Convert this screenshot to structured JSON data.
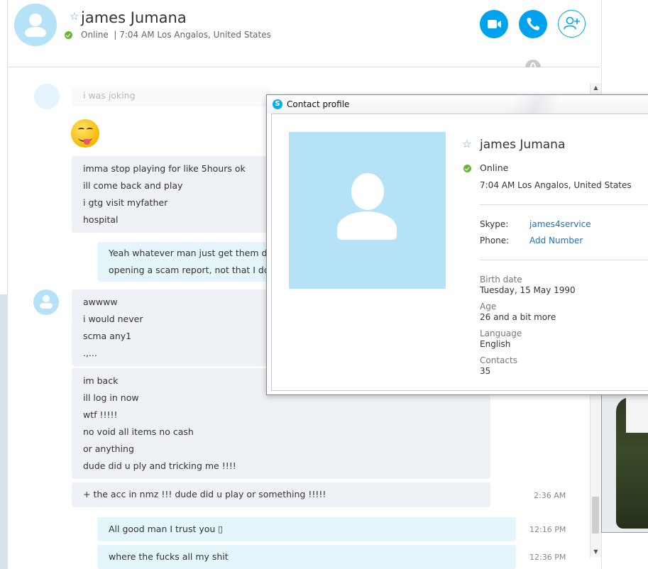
{
  "header": {
    "contact_name": "james Jumana",
    "status": "Online",
    "status_separator": "|",
    "local_time_location": "7:04 AM Los Angalos, United States",
    "icons": [
      "star-icon",
      "video-call-icon",
      "phone-icon",
      "add-person-icon",
      "globe-icon"
    ]
  },
  "chat": {
    "faded_message": "i was joking",
    "messages": [
      {
        "id": "m1",
        "direction": "in",
        "lines": [
          "imma stop playing for like 5hours ok",
          "ill come back and play",
          "i gtg visit myfather",
          "hospital"
        ]
      },
      {
        "id": "m2",
        "direction": "out",
        "lines": [
          "Yeah whatever man just get them down",
          "opening a scam report, not that I don't"
        ]
      },
      {
        "id": "m3",
        "direction": "in",
        "lines": [
          "awwww",
          "i would never",
          "scma any1",
          ".,..."
        ]
      },
      {
        "id": "m4",
        "direction": "in",
        "lines": [
          "im back",
          "ill log in now",
          "wtf !!!!!",
          "no void all items no cash",
          "or anything",
          "dude did u ply and tricking me !!!!"
        ]
      },
      {
        "id": "m5",
        "direction": "in",
        "lines": [
          "+ the acc in nmz !!! dude did u play or something !!!!!"
        ],
        "time": "2:36 AM"
      },
      {
        "id": "m6",
        "direction": "out",
        "lines": [
          "All good man I trust you ▯"
        ],
        "time": "12:16 PM"
      },
      {
        "id": "m7",
        "direction": "out",
        "lines": [
          "where the fucks all my shit"
        ],
        "time": "12:36 PM"
      }
    ]
  },
  "scrollbar": {
    "up_arrow": "▲",
    "down_arrow": "▼"
  },
  "profile": {
    "window_title": "Contact profile",
    "logo_letter": "S",
    "name": "james Jumana",
    "status": "Online",
    "location": "7:04 AM Los Angalos, United States",
    "skype_label": "Skype:",
    "skype_value": "james4service",
    "phone_label": "Phone:",
    "phone_value": "Add Number",
    "birth_label": "Birth date",
    "birth_value": "Tuesday, 15 May 1990",
    "age_label": "Age",
    "age_value": "26 and a bit more",
    "language_label": "Language",
    "language_value": "English",
    "contacts_label": "Contacts",
    "contacts_value": "35"
  },
  "colors": {
    "accent": "#00a2ed",
    "online": "#6bb536",
    "avatar_bg": "#b6e2f7",
    "incoming_bubble": "#eef1f5",
    "outgoing_bubble": "#e5f5fc",
    "link": "#1a73b8"
  }
}
